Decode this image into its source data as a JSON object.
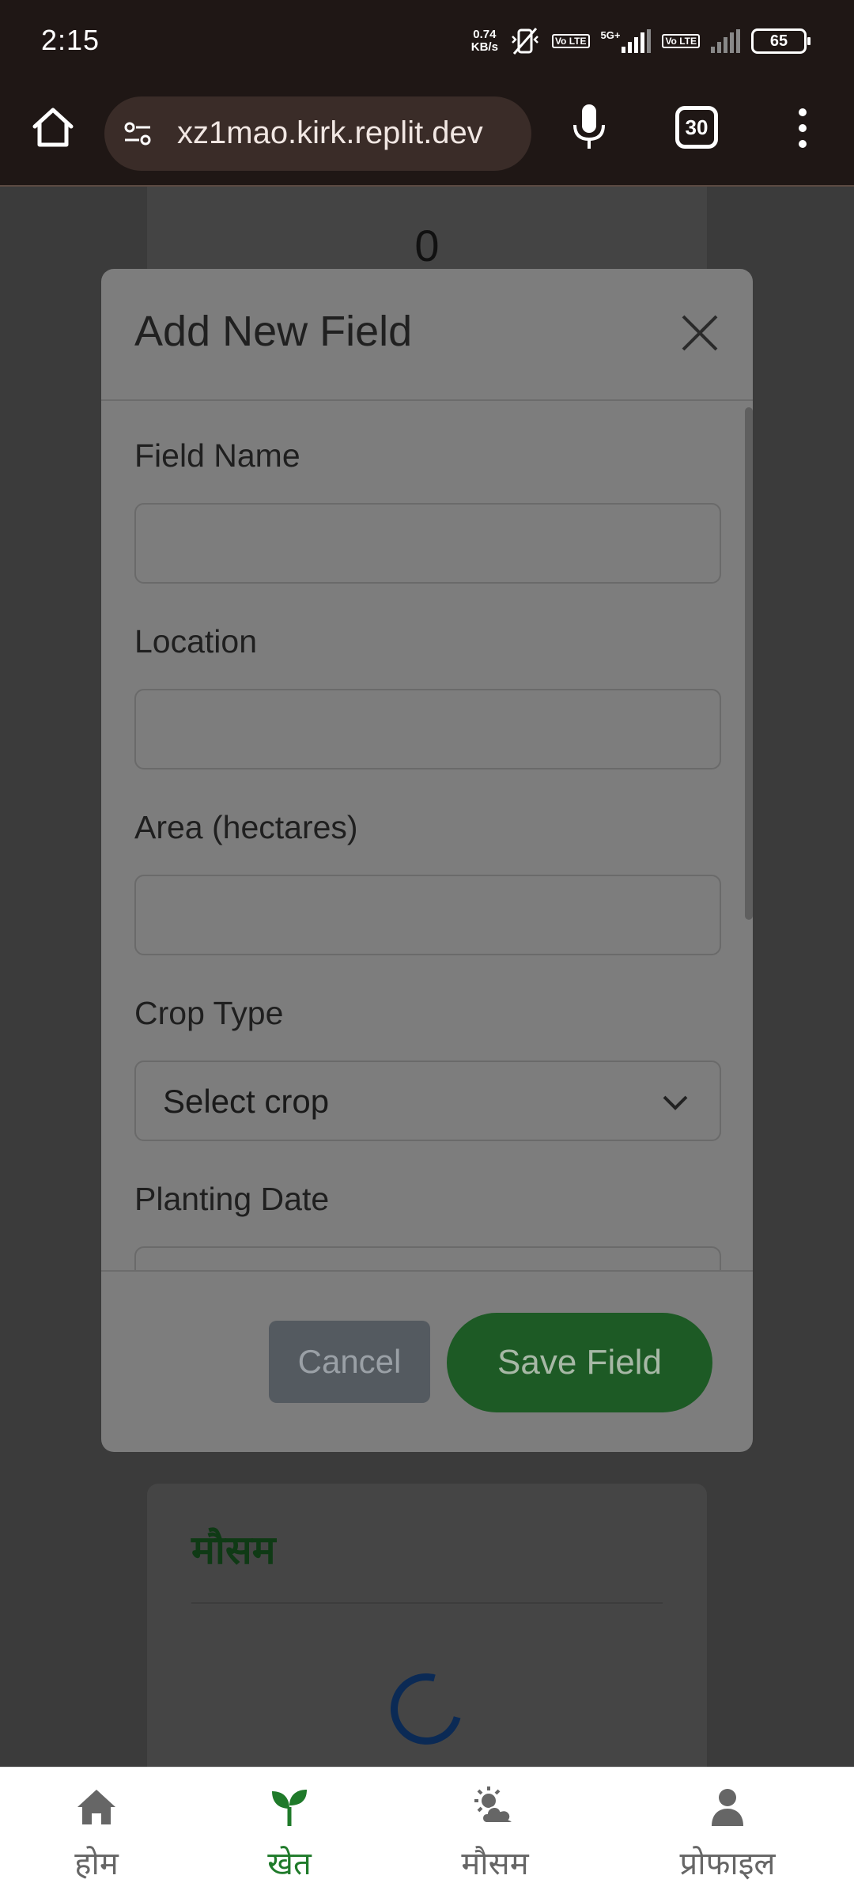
{
  "status_bar": {
    "time": "2:15",
    "net_speed_value": "0.74",
    "net_speed_unit": "KB/s",
    "volte_1": "Vo LTE",
    "network_type": "5G+",
    "volte_2": "Vo LTE",
    "battery": "65"
  },
  "browser": {
    "url": "xz1mao.kirk.replit.dev",
    "tab_count": "30"
  },
  "background_page": {
    "top_card_value": "0",
    "weather_card_title": "मौसम"
  },
  "modal": {
    "title": "Add New Field",
    "fields": [
      {
        "label": "Field Name",
        "value": ""
      },
      {
        "label": "Location",
        "value": ""
      },
      {
        "label": "Area (hectares)",
        "value": ""
      },
      {
        "label": "Crop Type",
        "selected": "Select crop"
      },
      {
        "label": "Planting Date",
        "value": ""
      }
    ],
    "cancel_label": "Cancel",
    "save_label": "Save Field"
  },
  "bottom_nav": {
    "items": [
      {
        "label": "होम",
        "icon": "home-icon",
        "active": false
      },
      {
        "label": "खेत",
        "icon": "sprout-icon",
        "active": true
      },
      {
        "label": "मौसम",
        "icon": "weather-icon",
        "active": false
      },
      {
        "label": "प्रोफाइल",
        "icon": "profile-icon",
        "active": false
      }
    ]
  },
  "colors": {
    "active_nav": "#1f7a2a",
    "save_button": "#1d5a25",
    "overlay": "#3b3b3b"
  }
}
